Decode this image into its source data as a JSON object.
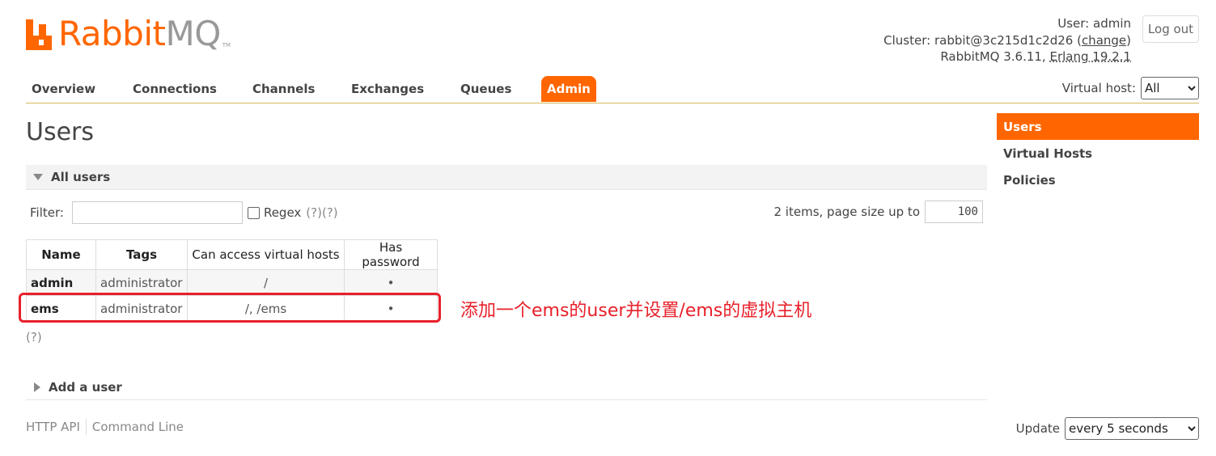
{
  "logo": {
    "rabbit": "Rabbit",
    "mq": "MQ",
    "tm": "TM"
  },
  "header": {
    "user_label": "User:",
    "user": "admin",
    "cluster_label": "Cluster:",
    "cluster": "rabbit@3c215d1c2d26",
    "change": "change",
    "version": "RabbitMQ 3.6.11,",
    "erlang": "Erlang 19.2.1",
    "logout": "Log out"
  },
  "nav": {
    "tabs": [
      "Overview",
      "Connections",
      "Channels",
      "Exchanges",
      "Queues",
      "Admin"
    ],
    "active": "Admin",
    "vhost_label": "Virtual host:",
    "vhost_value": "All"
  },
  "sidebar": {
    "items": [
      "Users",
      "Virtual Hosts",
      "Policies"
    ],
    "active": "Users"
  },
  "main": {
    "title": "Users",
    "section": "All users",
    "filter_label": "Filter:",
    "filter_value": "",
    "regex_label": "Regex",
    "help1": "(?)",
    "help2": "(?)",
    "paging_text": "2 items, page size up to",
    "page_size": "100",
    "columns": [
      "Name",
      "Tags",
      "Can access virtual hosts",
      "Has password"
    ],
    "rows": [
      {
        "name": "admin",
        "tags": "administrator",
        "vhosts": "/",
        "has_password": "•"
      },
      {
        "name": "ems",
        "tags": "administrator",
        "vhosts": "/, /ems",
        "has_password": "•"
      }
    ],
    "table_help": "(?)",
    "add_user": "Add a user"
  },
  "annotation": "添加一个ems的user并设置/ems的虚拟主机",
  "footer": {
    "http_api": "HTTP API",
    "command_line": "Command Line",
    "update_label": "Update",
    "update_value": "every 5 seconds"
  },
  "colors": {
    "accent": "#ff6600",
    "annotation": "#e8202a"
  }
}
